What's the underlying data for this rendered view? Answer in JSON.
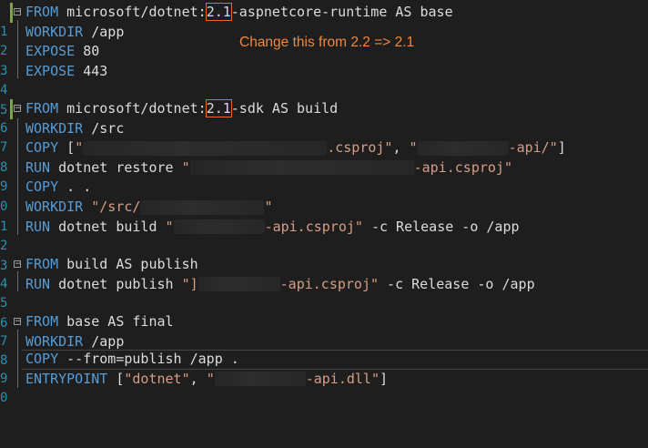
{
  "annotation": "Change this from 2.2 => 2.1",
  "lines": [
    {
      "num": "1",
      "kw": "FROM",
      "a": " microsoft/dotnet:",
      "v": "2.1",
      "b": "-aspnetcore-runtime AS base"
    },
    {
      "num": "2",
      "kw": "WORKDIR",
      "a": " /app"
    },
    {
      "num": "3",
      "kw": "EXPOSE",
      "a": " 80"
    },
    {
      "num": "4",
      "kw": "EXPOSE",
      "a": " 443"
    },
    {
      "num": "5"
    },
    {
      "num": "6",
      "kw": "FROM",
      "a": " microsoft/dotnet:",
      "v": "2.1",
      "b": "-sdk AS build"
    },
    {
      "num": "7",
      "kw": "WORKDIR",
      "a": " /src"
    },
    {
      "num": "8",
      "kw": "COPY",
      "a": " [",
      "s1": "\"",
      "s2": ".csproj\"",
      "c": ", ",
      "s3": "\"",
      "s4": "-api/\"",
      "e": "]"
    },
    {
      "num": "9",
      "kw": "RUN",
      "a": " dotnet restore ",
      "s1": "\"",
      "s2": "-api.csproj\""
    },
    {
      "num": "0",
      "kw": "COPY",
      "a": " . ."
    },
    {
      "num": "1",
      "kw": "WORKDIR",
      "s1": " \"/src/",
      "s2": "\""
    },
    {
      "num": "2",
      "kw": "RUN",
      "a": " dotnet build ",
      "s1": "\"",
      "s2": "-api.csproj\"",
      "e": " -c Release -o /app"
    },
    {
      "num": "3"
    },
    {
      "num": "4",
      "kw": "FROM",
      "a": " build AS publish"
    },
    {
      "num": "5",
      "kw": "RUN",
      "a": " dotnet publish ",
      "s1": "\"]",
      "s2": "-api.csproj\"",
      "e": " -c Release -o /app"
    },
    {
      "num": "6"
    },
    {
      "num": "7",
      "kw": "FROM",
      "a": " base AS final"
    },
    {
      "num": "8",
      "kw": "WORKDIR",
      "a": " /app"
    },
    {
      "num": "9",
      "kw": "COPY",
      "a": " --from=publish /app ."
    },
    {
      "num": "0",
      "kw": "ENTRYPOINT",
      "a": " [",
      "s1": "\"dotnet\"",
      "c": ", ",
      "s3": "\"",
      "s4": "-api.dll\"",
      "e": "]"
    }
  ]
}
